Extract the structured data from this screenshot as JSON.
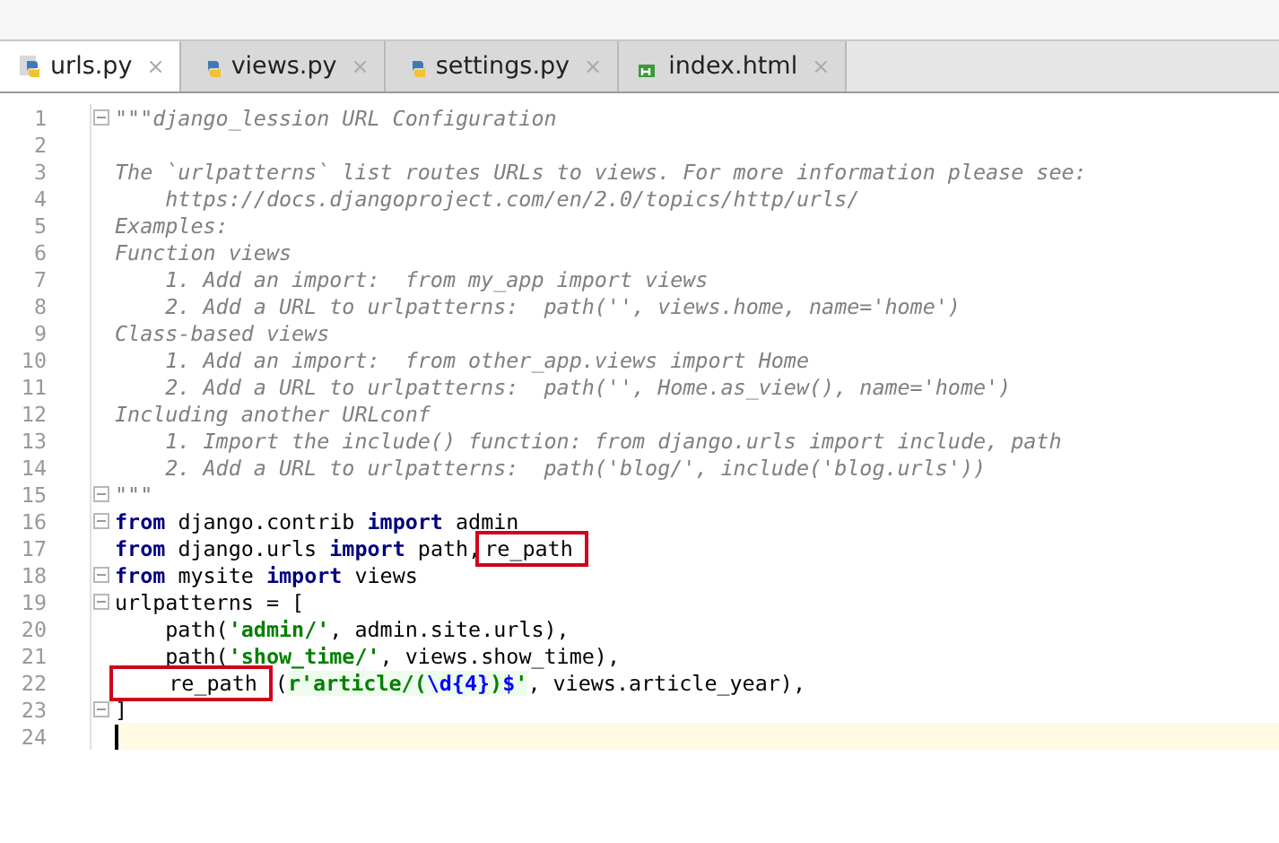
{
  "tabs": [
    {
      "label": "urls.py",
      "kind": "python",
      "selected": true,
      "close": "×"
    },
    {
      "label": "views.py",
      "kind": "python",
      "selected": false,
      "close": "×"
    },
    {
      "label": "settings.py",
      "kind": "python",
      "selected": false,
      "close": "×"
    },
    {
      "label": "index.html",
      "kind": "html",
      "selected": false,
      "close": "×"
    }
  ],
  "lines": [
    {
      "n": "1",
      "fold": true,
      "current": false,
      "tokens": [
        {
          "kind": "comment",
          "text": "\"\"\"django_lession URL Configuration"
        }
      ]
    },
    {
      "n": "2",
      "fold": false,
      "current": false
    },
    {
      "n": "3",
      "fold": false,
      "current": false,
      "tokens": [
        {
          "kind": "comment",
          "text": "The `urlpatterns` list routes URLs to views. For more information please see:"
        }
      ]
    },
    {
      "n": "4",
      "fold": false,
      "current": false,
      "tokens": [
        {
          "kind": "comment",
          "text": "    https://docs.djangoproject.com/en/2.0/topics/http/urls/"
        }
      ]
    },
    {
      "n": "5",
      "fold": false,
      "current": false,
      "tokens": [
        {
          "kind": "comment",
          "text": "Examples:"
        }
      ]
    },
    {
      "n": "6",
      "fold": false,
      "current": false,
      "tokens": [
        {
          "kind": "comment",
          "text": "Function views"
        }
      ]
    },
    {
      "n": "7",
      "fold": false,
      "current": false,
      "tokens": [
        {
          "kind": "comment",
          "text": "    1. Add an import:  from my_app import views"
        }
      ]
    },
    {
      "n": "8",
      "fold": false,
      "current": false,
      "tokens": [
        {
          "kind": "comment",
          "text": "    2. Add a URL to urlpatterns:  path('', views.home, name='home')"
        }
      ]
    },
    {
      "n": "9",
      "fold": false,
      "current": false,
      "tokens": [
        {
          "kind": "comment",
          "text": "Class-based views"
        }
      ]
    },
    {
      "n": "10",
      "fold": false,
      "current": false,
      "tokens": [
        {
          "kind": "comment",
          "text": "    1. Add an import:  from other_app.views import Home"
        }
      ]
    },
    {
      "n": "11",
      "fold": false,
      "current": false,
      "tokens": [
        {
          "kind": "comment",
          "text": "    2. Add a URL to urlpatterns:  path('', Home.as_view(), name='home')"
        }
      ]
    },
    {
      "n": "12",
      "fold": false,
      "current": false,
      "tokens": [
        {
          "kind": "comment",
          "text": "Including another URLconf"
        }
      ]
    },
    {
      "n": "13",
      "fold": false,
      "current": false,
      "tokens": [
        {
          "kind": "comment",
          "text": "    1. Import the include() function: from django.urls import include, path"
        }
      ]
    },
    {
      "n": "14",
      "fold": false,
      "current": false,
      "tokens": [
        {
          "kind": "comment",
          "text": "    2. Add a URL to urlpatterns:  path('blog/', include('blog.urls'))"
        }
      ]
    },
    {
      "n": "15",
      "fold": true,
      "current": false,
      "tokens": [
        {
          "kind": "comment",
          "text": "\"\"\""
        }
      ]
    },
    {
      "n": "16",
      "fold": true,
      "current": false,
      "tokens": [
        {
          "kind": "keyword",
          "text": "from"
        },
        {
          "kind": "plain",
          "text": " django.contrib "
        },
        {
          "kind": "keyword",
          "text": "import"
        },
        {
          "kind": "plain",
          "text": " admin"
        }
      ]
    },
    {
      "n": "17",
      "fold": false,
      "current": false,
      "tokens": [
        {
          "kind": "keyword",
          "text": "from"
        },
        {
          "kind": "plain",
          "text": " django.urls "
        },
        {
          "kind": "keyword",
          "text": "import"
        },
        {
          "kind": "plain",
          "text": " path,"
        },
        {
          "kind": "plain",
          "text": "re_path",
          "boxed": true
        }
      ]
    },
    {
      "n": "18",
      "fold": true,
      "current": false,
      "tokens": [
        {
          "kind": "keyword",
          "text": "from"
        },
        {
          "kind": "plain",
          "text": " mysite "
        },
        {
          "kind": "keyword",
          "text": "import"
        },
        {
          "kind": "plain",
          "text": " views"
        }
      ]
    },
    {
      "n": "19",
      "fold": true,
      "current": false,
      "tokens": [
        {
          "kind": "plain",
          "text": "urlpatterns = ["
        }
      ]
    },
    {
      "n": "20",
      "fold": false,
      "current": false,
      "tokens": [
        {
          "kind": "plain",
          "text": "    path("
        },
        {
          "kind": "string",
          "text": "'admin/'"
        },
        {
          "kind": "plain",
          "text": ", admin.site.urls),"
        }
      ]
    },
    {
      "n": "21",
      "fold": false,
      "current": false,
      "tokens": [
        {
          "kind": "plain",
          "text": "    path("
        },
        {
          "kind": "string",
          "text": "'show_time/'"
        },
        {
          "kind": "plain",
          "text": ", views.show_time),"
        }
      ]
    },
    {
      "n": "22",
      "fold": false,
      "current": false,
      "tokens": [
        {
          "kind": "plain",
          "text": "    re_path",
          "boxed": true
        },
        {
          "kind": "plain",
          "text": "("
        },
        {
          "kind": "regex",
          "text": "r'article/("
        },
        {
          "kind": "escape",
          "text": "\\d{4}"
        },
        {
          "kind": "regex",
          "text": ")"
        },
        {
          "kind": "escape",
          "text": "$"
        },
        {
          "kind": "regex",
          "text": "'"
        },
        {
          "kind": "plain",
          "text": ", views.article_year),"
        }
      ]
    },
    {
      "n": "23",
      "fold": true,
      "current": false,
      "tokens": [
        {
          "kind": "plain",
          "text": "]"
        }
      ]
    },
    {
      "n": "24",
      "fold": false,
      "current": true
    }
  ]
}
